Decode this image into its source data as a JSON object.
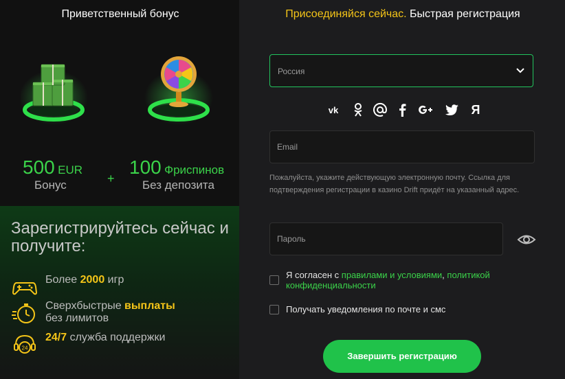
{
  "left": {
    "title": "Приветственный бонус",
    "bonus1": {
      "amount": "500",
      "unit": "EUR",
      "label": "Бонус",
      "icon": "money-stacks-icon"
    },
    "plus": "+",
    "bonus2": {
      "amount": "100",
      "unit": "Фриспинов",
      "label": "Без депозита",
      "icon": "fortune-wheel-icon"
    },
    "promo_title": "Зарегистрируйтесь сейчас и получите:",
    "features": [
      {
        "icon": "gamepad-icon",
        "pre": "Более ",
        "hl": "2000",
        "post": " игр"
      },
      {
        "icon": "stopwatch-icon",
        "pre": "Сверхбыстрые ",
        "hl": "выплаты",
        "post": "без лимитов"
      },
      {
        "icon": "support-24-icon",
        "pre": "",
        "hl": "24/7",
        "post": " служба поддержки"
      }
    ]
  },
  "right": {
    "title_highlight": "Присоединяйся сейчас.",
    "title_rest": " Быстрая регистрация",
    "country": "Россия",
    "socials": [
      "vk-icon",
      "odnoklassniki-icon",
      "mail-at-icon",
      "facebook-icon",
      "google-plus-icon",
      "twitter-icon",
      "yandex-icon"
    ],
    "yandex_glyph": "Я",
    "email_placeholder": "Email",
    "email_hint": "Пожалуйста, укажите действующую электронную почту. Ссылка для подтверждения регистрации в казино Drift придёт на указанный адрес.",
    "password_placeholder": "Пароль",
    "agree_pre": "Я согласен с ",
    "agree_link1": "правилами и условиями",
    "agree_sep": ", ",
    "agree_link2": "политикой конфиденциальности",
    "notify_label": "Получать уведомления по почте и смс",
    "submit_label": "Завершить регистрацию"
  },
  "colors": {
    "accent_green": "#22c55e",
    "highlight_yellow": "#f5c518"
  }
}
